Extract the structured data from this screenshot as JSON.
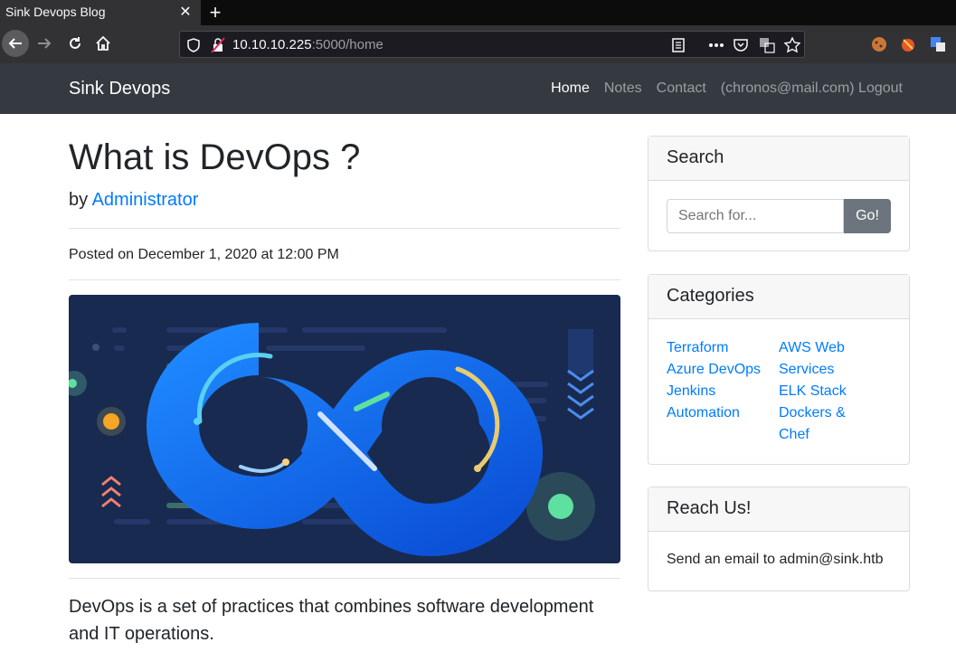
{
  "browser": {
    "tab_title": "Sink Devops Blog",
    "tab_close": "✕",
    "new_tab": "+",
    "url_host": "10.10.10.225",
    "url_rest": ":5000/home"
  },
  "site": {
    "brand": "Sink Devops",
    "nav": [
      "Home",
      "Notes",
      "Contact",
      "(chronos@mail.com) Logout"
    ],
    "active_nav": "Home"
  },
  "post": {
    "title": "What is DevOps ?",
    "by": "by",
    "author": "Administrator",
    "posted": "Posted on December 1, 2020 at 12:00 PM",
    "lead": "DevOps is a set of practices that combines software development and IT operations."
  },
  "sidebar": {
    "search": {
      "title": "Search",
      "placeholder": "Search for...",
      "button": "Go!"
    },
    "categories": {
      "title": "Categories",
      "left": [
        "Terraform",
        "Azure DevOps",
        "Jenkins",
        "Automation"
      ],
      "right": [
        "AWS Web",
        "Services",
        "ELK Stack",
        "Dockers &",
        "Chef"
      ]
    },
    "reach": {
      "title": "Reach Us!",
      "text": "Send an email to admin@sink.htb"
    }
  },
  "colors": {
    "link": "#007bff",
    "navbar": "#343a40",
    "hero_bg": "#192a50"
  }
}
